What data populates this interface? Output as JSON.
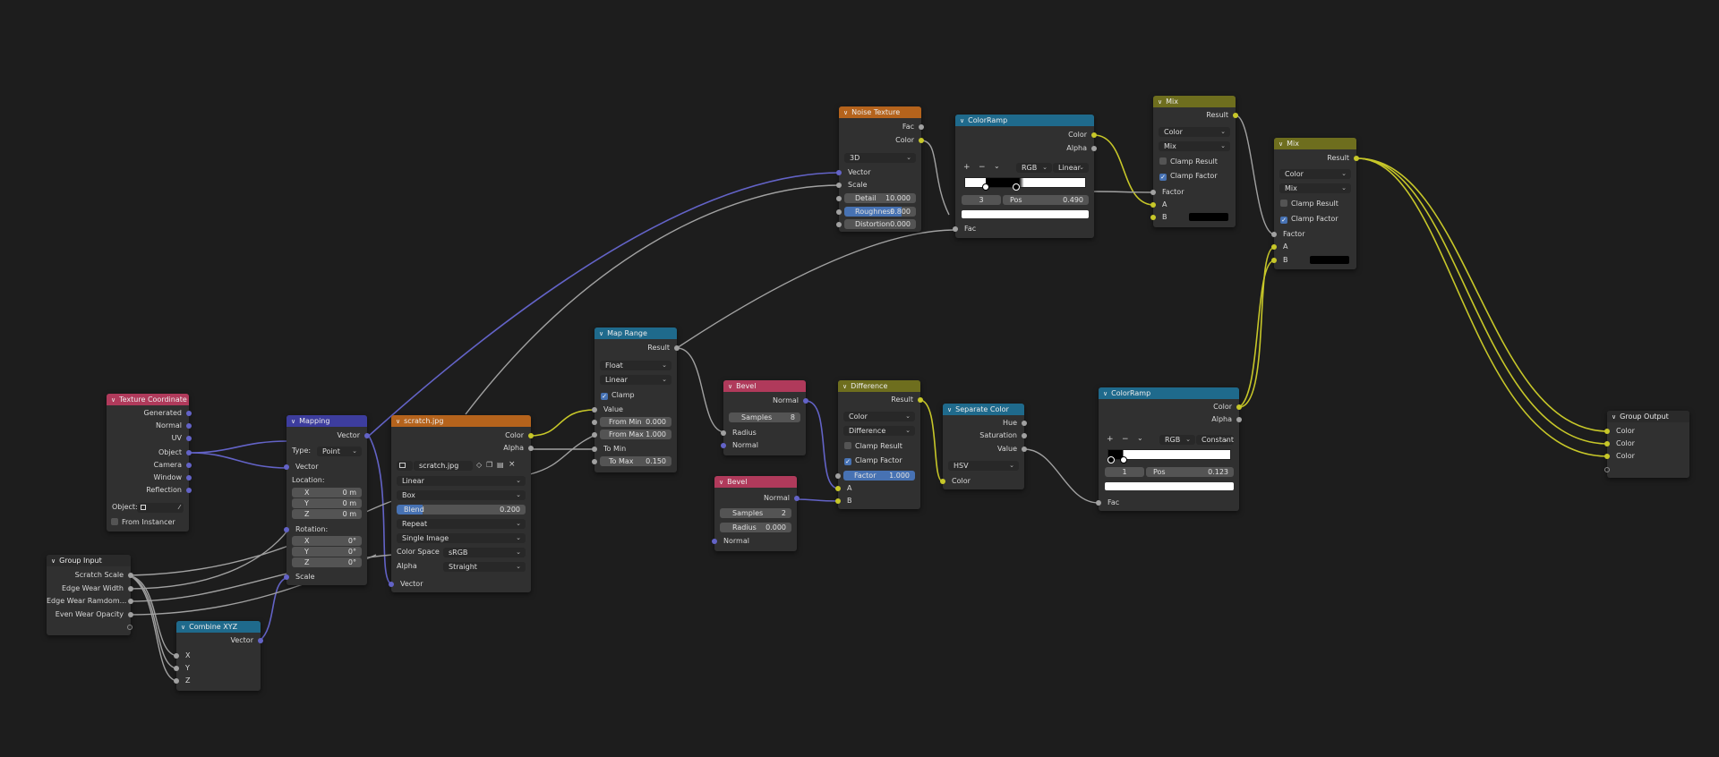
{
  "colors": {
    "background": "#1d1d1d",
    "node_body": "#303030",
    "header_input": "#b03a5b",
    "header_vector": "#3d3d9e",
    "header_texture": "#b5631c",
    "header_converter": "#1f6a8c",
    "header_color": "#6e6e1e",
    "socket_float": "#a1a1a1",
    "socket_color": "#c7c729",
    "socket_vector": "#6363c7"
  },
  "texcoord": {
    "title": "Texture Coordinate",
    "out_generated": "Generated",
    "out_normal": "Normal",
    "out_uv": "UV",
    "out_object": "Object",
    "out_camera": "Camera",
    "out_window": "Window",
    "out_reflection": "Reflection",
    "object_label": "Object:",
    "from_instancer": "From Instancer"
  },
  "mapping": {
    "title": "Mapping",
    "out_vector": "Vector",
    "type_label": "Type:",
    "type_value": "Point",
    "in_vector": "Vector",
    "location_label": "Location:",
    "loc_x_label": "X",
    "loc_x": "0 m",
    "loc_y_label": "Y",
    "loc_y": "0 m",
    "loc_z_label": "Z",
    "loc_z": "0 m",
    "rotation_label": "Rotation:",
    "rot_x_label": "X",
    "rot_x": "0°",
    "rot_y_label": "Y",
    "rot_y": "0°",
    "rot_z_label": "Z",
    "rot_z": "0°",
    "in_scale": "Scale"
  },
  "image": {
    "title": "scratch.jpg",
    "out_color": "Color",
    "out_alpha": "Alpha",
    "image_name": "scratch.jpg",
    "interpolation": "Linear",
    "projection": "Box",
    "blend_label": "Blend",
    "blend_value": "0.200",
    "extension": "Repeat",
    "source": "Single Image",
    "colorspace_label": "Color Space",
    "colorspace_value": "sRGB",
    "alpha_label": "Alpha",
    "alpha_value": "Straight",
    "in_vector": "Vector"
  },
  "group_input": {
    "title": "Group Input",
    "out_scratch_scale": "Scratch Scale",
    "out_edge_wear_width": "Edge Wear Width",
    "out_edge_wear_random": "Edge Wear Ramdom...",
    "out_even_wear_opacity": "Even Wear Opacity"
  },
  "combine": {
    "title": "Combine XYZ",
    "out_vector": "Vector",
    "in_x": "X",
    "in_y": "Y",
    "in_z": "Z"
  },
  "noise": {
    "title": "Noise Texture",
    "out_fac": "Fac",
    "out_color": "Color",
    "dimensions": "3D",
    "in_vector": "Vector",
    "in_scale": "Scale",
    "detail_label": "Detail",
    "detail_value": "10.000",
    "roughness_label": "Roughness",
    "roughness_value": "0.800",
    "distortion_label": "Distortion",
    "distortion_value": "0.000"
  },
  "maprange": {
    "title": "Map Range",
    "out_result": "Result",
    "data_type": "Float",
    "interpolation": "Linear",
    "clamp_label": "Clamp",
    "in_value": "Value",
    "from_min_label": "From Min",
    "from_min_value": "0.000",
    "from_max_label": "From Max",
    "from_max_value": "1.000",
    "to_min_label": "To Min",
    "to_max_label": "To Max",
    "to_max_value": "0.150"
  },
  "bevel1": {
    "title": "Bevel",
    "out_normal": "Normal",
    "samples_label": "Samples",
    "samples_value": "8",
    "in_radius": "Radius",
    "in_normal": "Normal"
  },
  "bevel2": {
    "title": "Bevel",
    "out_normal": "Normal",
    "samples_label": "Samples",
    "samples_value": "2",
    "radius_label": "Radius",
    "radius_value": "0.000",
    "in_normal": "Normal"
  },
  "ramp1": {
    "title": "ColorRamp",
    "out_color": "Color",
    "out_alpha": "Alpha",
    "plus": "+",
    "minus": "−",
    "mode": "RGB",
    "interpolation": "Linear",
    "stop_index": "3",
    "pos_label": "Pos",
    "pos_value": "0.490",
    "in_fac": "Fac"
  },
  "difference": {
    "title": "Difference",
    "out_result": "Result",
    "data_type": "Color",
    "blend": "Difference",
    "clamp_result": "Clamp Result",
    "clamp_factor": "Clamp Factor",
    "factor_label": "Factor",
    "factor_value": "1.000",
    "in_a": "A",
    "in_b": "B"
  },
  "separate": {
    "title": "Separate Color",
    "out_hue": "Hue",
    "out_saturation": "Saturation",
    "out_value": "Value",
    "mode": "HSV",
    "in_color": "Color"
  },
  "ramp2": {
    "title": "ColorRamp",
    "out_color": "Color",
    "out_alpha": "Alpha",
    "plus": "+",
    "minus": "−",
    "mode": "RGB",
    "interpolation": "Constant",
    "stop_index": "1",
    "pos_label": "Pos",
    "pos_value": "0.123",
    "in_fac": "Fac"
  },
  "mix1": {
    "title": "Mix",
    "out_result": "Result",
    "data_type": "Color",
    "blend": "Mix",
    "clamp_result": "Clamp Result",
    "clamp_factor": "Clamp Factor",
    "in_factor": "Factor",
    "in_a": "A",
    "in_b": "B"
  },
  "mix2": {
    "title": "Mix",
    "out_result": "Result",
    "data_type": "Color",
    "blend": "Mix",
    "clamp_result": "Clamp Result",
    "clamp_factor": "Clamp Factor",
    "in_factor": "Factor",
    "in_a": "A",
    "in_b": "B"
  },
  "group_output": {
    "title": "Group Output",
    "in_color1": "Color",
    "in_color2": "Color",
    "in_color3": "Color"
  }
}
